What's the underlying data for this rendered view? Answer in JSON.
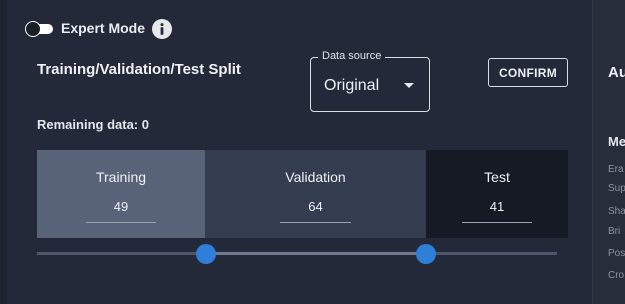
{
  "expert_mode": {
    "label": "Expert Mode",
    "enabled": false
  },
  "split": {
    "title": "Training/Validation/Test Split",
    "remaining": "Remaining data: 0",
    "training": {
      "label": "Training",
      "value": "49"
    },
    "validation": {
      "label": "Validation",
      "value": "64"
    },
    "test": {
      "label": "Test",
      "value": "41"
    },
    "slider": {
      "low": 49,
      "high": 113,
      "total": 154
    }
  },
  "data_source": {
    "legend": "Data source",
    "value": "Original"
  },
  "confirm_label": "CONFIRM",
  "right_panel": {
    "title": "Au",
    "subtitle": "Me",
    "items": [
      "Era",
      "Sup",
      "Sha",
      "Bri",
      "Pos",
      "Cro"
    ]
  },
  "colors": {
    "background": "#232938",
    "training": "#586378",
    "validation": "#343d50",
    "test": "#151a24",
    "slider_accent": "#2e7fd8"
  }
}
